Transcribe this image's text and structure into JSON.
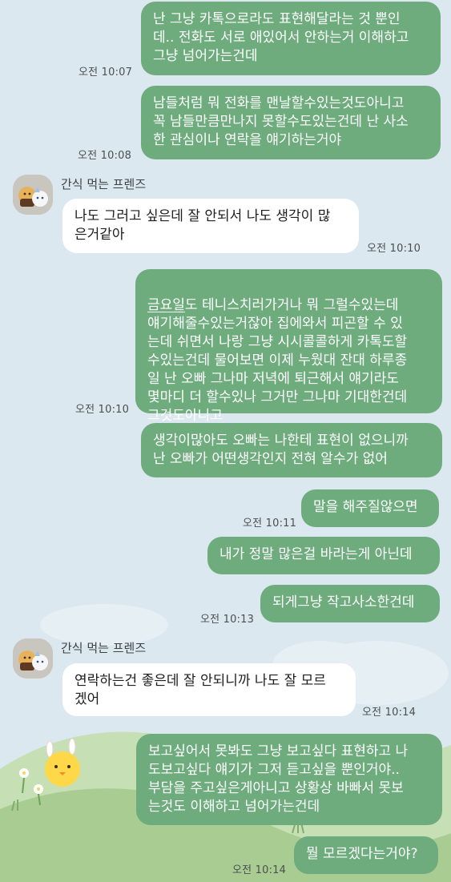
{
  "background": {
    "sky_color": "#dbe8ef",
    "hill_color": "#b9d6a6",
    "hill_dark": "#9fc389",
    "flower_color": "#ffffff",
    "chick_color": "#ffd84a"
  },
  "colors": {
    "outgoing_bubble": "#6eac7e",
    "incoming_bubble": "#ffffff"
  },
  "contact": {
    "name": "간식 먹는 프렌즈",
    "avatar_icon": "snack-friends-avatar-icon"
  },
  "messages": [
    {
      "id": "m1",
      "direction": "out",
      "text": "난 그냥 카톡으로라도 표현해달라는 것 뿐인\n데.. 전화도 서로 애있어서 안하는거 이해하고\n그냥 넘어가는건데",
      "time": "오전 10:07"
    },
    {
      "id": "m2",
      "direction": "out",
      "text": "남들처럼 뭐 전화를 맨날할수있는것도아니고\n꼭 남들만큼만나지 못할수도있는건데 난 사소\n한 관심이나 연락을 얘기하는거야",
      "time": "오전 10:08"
    },
    {
      "id": "m3",
      "direction": "in",
      "sender": "간식 먹는 프렌즈",
      "text": "나도 그러고 싶은데 잘 안되서 나도 생각이 많\n은거같아",
      "time": "오전 10:10"
    },
    {
      "id": "m4",
      "direction": "out",
      "underline_prefix": "금요일",
      "text": "도 테니스치러가거나 뭐 그럴수있는데\n얘기해줄수있는거잖아 집에와서 피곤할 수 있\n는데 쉬면서 나랑 그냥 시시콜콜하게 카톡도할\n수있는건데 물어보면 이제 누웠대 잔대 하루종\n일 난 오빠 그나마 저녁에 퇴근해서 얘기라도\n몇마디 더 할수있나 그거만 그나마 기대한건데\n그것도아니고",
      "time": "오전 10:10"
    },
    {
      "id": "m5",
      "direction": "out",
      "text": "생각이많아도 오빠는 나한테 표현이 없으니까\n난 오빠가 어떤생각인지 전혀 알수가 없어"
    },
    {
      "id": "m6",
      "direction": "out",
      "text": "말을 해주질않으면",
      "time": "오전 10:11"
    },
    {
      "id": "m7",
      "direction": "out",
      "text": "내가 정말 많은걸 바라는게 아닌데"
    },
    {
      "id": "m8",
      "direction": "out",
      "text": "되게그냥 작고사소한건데",
      "time": "오전 10:13"
    },
    {
      "id": "m9",
      "direction": "in",
      "sender": "간식 먹는 프렌즈",
      "text": "연락하는건 좋은데 잘 안되니까 나도 잘 모르\n겠어",
      "time": "오전 10:14"
    },
    {
      "id": "m10",
      "direction": "out",
      "text": "보고싶어서 못봐도 그냥 보고싶다 표현하고 나\n도보고싶다 얘기가 그저 듣고싶을 뿐인거야..\n부담을 주고싶은게아니고 상황상 바빠서 못보\n는것도 이해하고 넘어가는건데"
    },
    {
      "id": "m11",
      "direction": "out",
      "text": "뭘 모르겠다는거야?",
      "time": "오전 10:14"
    }
  ]
}
